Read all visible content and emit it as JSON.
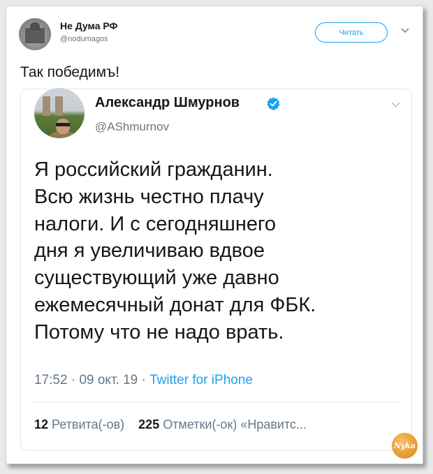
{
  "outer_tweet": {
    "author_name": "Не Дума РФ",
    "author_handle": "@nodumagos",
    "follow_label": "Читать",
    "text": "Так победимъ!"
  },
  "quoted_tweet": {
    "author_name": "Александр Шмурнов",
    "author_handle": "@AShmurnov",
    "text": "Я российский гражданин.\nВсю жизнь честно плачу\nналоги. И с сегодняшнего\nдня я увеличиваю вдвое\nсуществующий уже давно\nежемесячный донат для ФБК.\nПотому что не надо врать.",
    "time": "17:52",
    "date": "09 окт. 19",
    "separator": " · ",
    "source": "Twitter for iPhone",
    "retweets_count": "12",
    "retweets_label": "Ретвита(-ов)",
    "likes_count": "225",
    "likes_label": "Отметки(-ок) «Нравитс..."
  },
  "watermark": {
    "text": "Nyka"
  },
  "colors": {
    "accent": "#1da1f2",
    "text": "#14171a",
    "muted": "#657786"
  },
  "icons": [
    "avatar-outer",
    "verified-badge-icon",
    "chevron-down-icon"
  ]
}
